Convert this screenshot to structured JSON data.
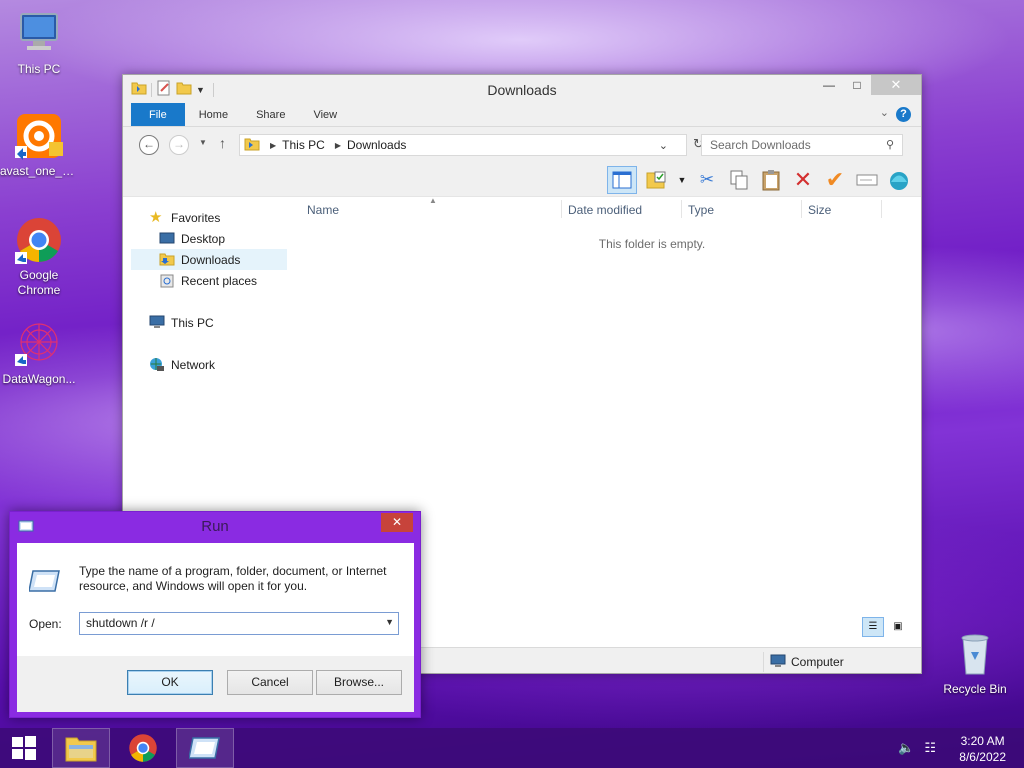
{
  "desktop": {
    "icons": [
      {
        "label": "This PC"
      },
      {
        "label": "avast_one_e..."
      },
      {
        "label": "Google Chrome"
      },
      {
        "label": "DataWagon..."
      },
      {
        "label": "Recycle Bin"
      }
    ]
  },
  "explorer": {
    "title": "Downloads",
    "tabs": [
      "File",
      "Home",
      "Share",
      "View"
    ],
    "breadcrumb": [
      "This PC",
      "Downloads"
    ],
    "search_placeholder": "Search Downloads",
    "nav": {
      "favorites": "Favorites",
      "desktop": "Desktop",
      "downloads": "Downloads",
      "recent": "Recent places",
      "this_pc": "This PC",
      "network": "Network"
    },
    "columns": [
      "Name",
      "Date modified",
      "Type",
      "Size"
    ],
    "empty_message": "This folder is empty.",
    "status_location": "Computer"
  },
  "run": {
    "title": "Run",
    "description": "Type the name of a program, folder, document, or Internet resource, and Windows will open it for you.",
    "open_label": "Open:",
    "command": "shutdown /r /",
    "ok": "OK",
    "cancel": "Cancel",
    "browse": "Browse..."
  },
  "taskbar": {
    "time": "3:20 AM",
    "date": "8/6/2022"
  }
}
